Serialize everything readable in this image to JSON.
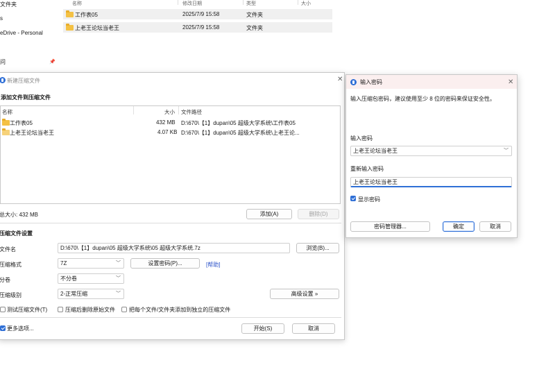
{
  "explorer": {
    "nav": [
      "文件夹",
      "s",
      "eDrive - Personal",
      "问"
    ],
    "columns": [
      "名称",
      "修改日期",
      "类型",
      "大小"
    ],
    "rows": [
      {
        "name": "工作表05",
        "date": "2025/7/9 15:58",
        "type": "文件夹"
      },
      {
        "name": "上老王论坛当老王",
        "date": "2025/7/9 15:58",
        "type": "文件夹"
      }
    ]
  },
  "archive_dialog": {
    "title": "新建压缩文件",
    "add_section_title": "添加文件到压缩文件",
    "list_columns": {
      "name": "名称",
      "size": "大小",
      "path": "文件路径"
    },
    "files": [
      {
        "name": "工作表05",
        "size": "432 MB",
        "path": "D:\\670\\【1】dupan\\05 超级大学系统\\工作表05"
      },
      {
        "name": "上老王论坛当老王",
        "size": "4.07 KB",
        "path": "D:\\670\\【1】dupan\\05 超级大学系统\\上老王论..."
      }
    ],
    "total_size": "总大小: 432 MB",
    "add_button": "添加(A)",
    "delete_button": "删除(D)",
    "settings_title": "压缩文件设置",
    "filename_label": "文件名",
    "filename_value": "D:\\670\\【1】dupan\\05 超级大学系统\\05 超级大学系统.7z",
    "browse_button": "浏览(B)...",
    "format_label": "压缩格式",
    "format_value": "7Z",
    "set_password_button": "设置密码(P)...",
    "help_link": "[帮助]",
    "split_label": "分卷",
    "split_value": "不分卷",
    "level_label": "压缩级别",
    "level_value": "2-正常压缩",
    "advanced_button": "高级设置 »",
    "options": [
      "测试压缩文件(T)",
      "压缩后删除原始文件",
      "把每个文件/文件夹添加到独立的压缩文件"
    ],
    "more_options": "更多选项...",
    "start_button": "开始(S)",
    "cancel_button": "取消"
  },
  "password_dialog": {
    "title": "输入密码",
    "hint": "输入压缩包密码，建议使用至少 8 位的密码来保证安全性。",
    "password_label": "输入密码",
    "password_value": "上老王论坛当老王",
    "confirm_label": "重新输入密码",
    "confirm_value": "上老王论坛当老王",
    "show_password": "显示密码",
    "manager_button": "密码管理器...",
    "ok_button": "确定",
    "cancel_button": "取消"
  },
  "colors": {
    "accent": "#2f6fd6",
    "folder": "#f4c144",
    "title_tint": "#fbefef",
    "link": "#2b52c9"
  }
}
